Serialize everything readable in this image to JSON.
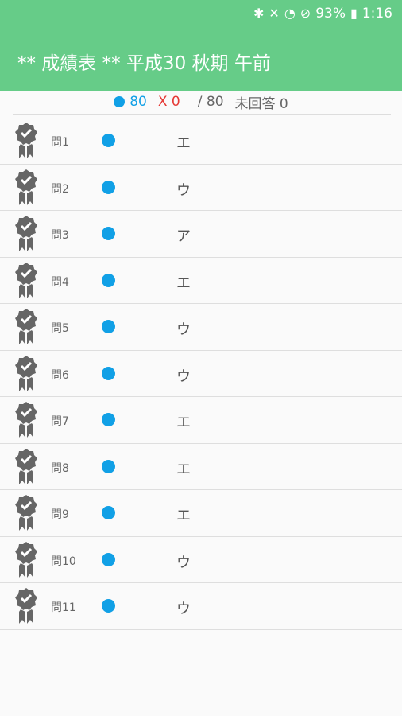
{
  "statusbar": {
    "bluetooth_icon": "bluetooth-icon",
    "mute_icon": "vibrate-mute-icon",
    "wifi_icon": "wifi-icon",
    "dnd_icon": "do-not-disturb-icon",
    "battery_percent": "93%",
    "time": "1:16"
  },
  "header": {
    "title": "** 成績表 ** 平成30 秋期 午前",
    "background": "#66cc88"
  },
  "summary": {
    "correct": "80",
    "wrong": "X 0",
    "total": "/ 80",
    "unanswered": "未回答 0",
    "correct_color": "#11a0e6",
    "wrong_color": "#e53935"
  },
  "rows": [
    {
      "q": "問1",
      "answer": "エ"
    },
    {
      "q": "問2",
      "answer": "ウ"
    },
    {
      "q": "問3",
      "answer": "ア"
    },
    {
      "q": "問4",
      "answer": "エ"
    },
    {
      "q": "問5",
      "answer": "ウ"
    },
    {
      "q": "問6",
      "answer": "ウ"
    },
    {
      "q": "問7",
      "answer": "エ"
    },
    {
      "q": "問8",
      "answer": "エ"
    },
    {
      "q": "問9",
      "answer": "エ"
    },
    {
      "q": "問10",
      "answer": "ウ"
    },
    {
      "q": "問11",
      "answer": "ウ"
    }
  ]
}
